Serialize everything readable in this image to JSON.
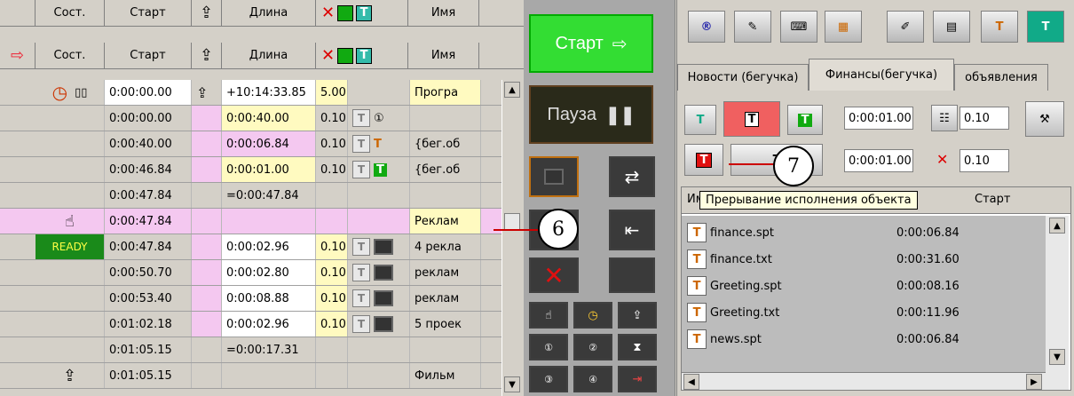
{
  "header": {
    "col_state": "Сост.",
    "col_start": "Старт",
    "col_length": "Длина",
    "col_name": "Имя"
  },
  "rows": [
    {
      "start": "0:00:00.00",
      "length": "+10:14:33.85",
      "val": "5.00",
      "name": "Програ"
    },
    {
      "start": "0:00:00.00",
      "length": "0:00:40.00",
      "val": "0.10",
      "name": ""
    },
    {
      "start": "0:00:40.00",
      "length": "0:00:06.84",
      "val": "0.10",
      "name": "{бег.об"
    },
    {
      "start": "0:00:46.84",
      "length": "0:00:01.00",
      "val": "0.10",
      "name": "{бег.об"
    },
    {
      "start": "0:00:47.84",
      "length": "=0:00:47.84",
      "val": "",
      "name": ""
    },
    {
      "start": "0:00:47.84",
      "length": "",
      "val": "",
      "name": "Реклам"
    },
    {
      "start": "0:00:47.84",
      "length": "0:00:02.96",
      "val": "0.10",
      "name": "4 рекла"
    },
    {
      "start": "0:00:50.70",
      "length": "0:00:02.80",
      "val": "0.10",
      "name": "реклам"
    },
    {
      "start": "0:00:53.40",
      "length": "0:00:08.88",
      "val": "0.10",
      "name": "реклам"
    },
    {
      "start": "0:01:02.18",
      "length": "0:00:02.96",
      "val": "0.10",
      "name": "5 проек"
    },
    {
      "start": "0:01:05.15",
      "length": "=0:00:17.31",
      "val": "",
      "name": ""
    },
    {
      "start": "0:01:05.15",
      "length": "",
      "val": "",
      "name": "Фильм"
    }
  ],
  "ready_label": "READY",
  "middle": {
    "start_label": "Старт",
    "pause_label": "Пауза"
  },
  "callouts": {
    "six": "6",
    "seven": "7"
  },
  "right": {
    "tabs": [
      "Новости (бегучка)",
      "Финансы(бегучка)",
      "объявления"
    ],
    "field1": "0:00:01.00",
    "field1b": "0.10",
    "field2": "0:00:01.00",
    "field2b": "0.10",
    "tooltip": "Прерывание исполнения объекта",
    "col_name_partial": "Им",
    "col_start": "Старт",
    "files": [
      {
        "name": "finance.spt",
        "time": "0:00:06.84"
      },
      {
        "name": "finance.txt",
        "time": "0:00:31.60"
      },
      {
        "name": "Greeting.spt",
        "time": "0:00:08.16"
      },
      {
        "name": "Greeting.txt",
        "time": "0:00:11.96"
      },
      {
        "name": "news.spt",
        "time": "0:00:06.84"
      }
    ]
  },
  "colors": {
    "start_green": "#33dd33",
    "pause_dark": "#2a2a1a",
    "accent_red": "#e01010"
  }
}
